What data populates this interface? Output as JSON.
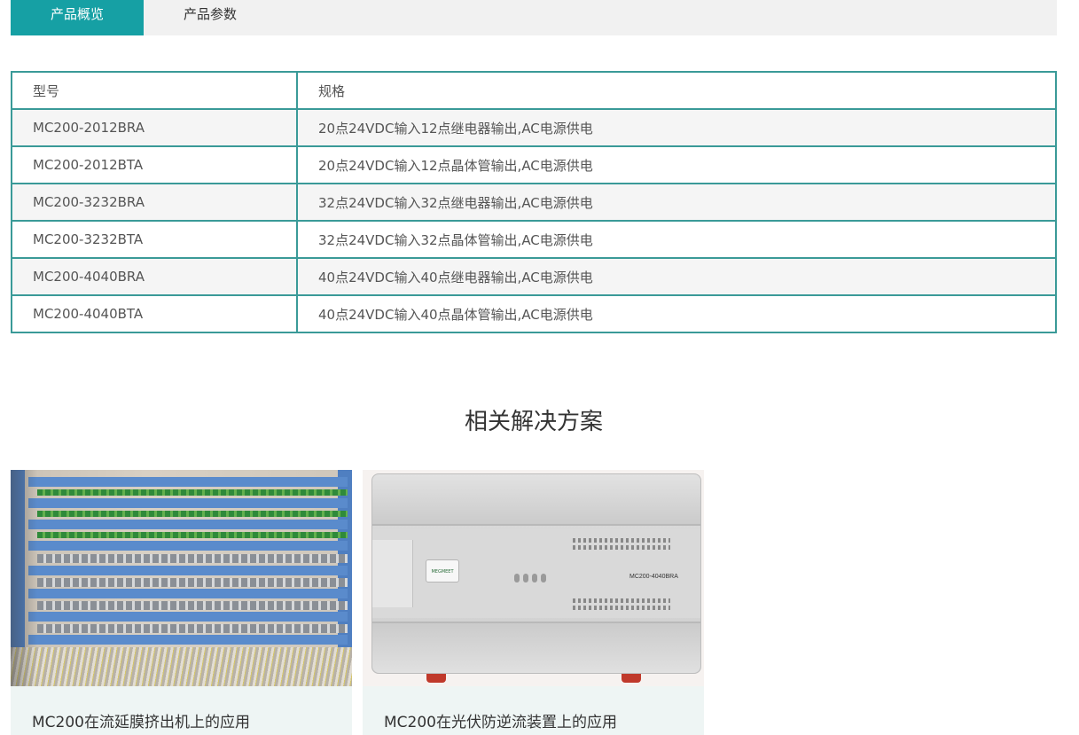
{
  "tabs": [
    {
      "label": "产品概览",
      "active": true
    },
    {
      "label": "产品参数",
      "active": false
    }
  ],
  "spec_table": {
    "headers": [
      "型号",
      "规格"
    ],
    "rows": [
      [
        "MC200-2012BRA",
        "20点24VDC输入12点继电器输出,AC电源供电"
      ],
      [
        "MC200-2012BTA",
        "20点24VDC输入12点晶体管输出,AC电源供电"
      ],
      [
        "MC200-3232BRA",
        "32点24VDC输入32点继电器输出,AC电源供电"
      ],
      [
        "MC200-3232BTA",
        "32点24VDC输入32点晶体管输出,AC电源供电"
      ],
      [
        "MC200-4040BRA",
        "40点24VDC输入40点继电器输出,AC电源供电"
      ],
      [
        "MC200-4040BTA",
        "40点24VDC输入40点晶体管输出,AC电源供电"
      ]
    ]
  },
  "solutions": {
    "title": "相关解决方案",
    "cards": [
      {
        "caption": "MC200在流延膜挤出机上的应用"
      },
      {
        "caption": "MC200在光伏防逆流装置上的应用"
      }
    ]
  },
  "plc_image": {
    "brand": "MEGMEET",
    "model": "MC200-4040BRA"
  },
  "colors": {
    "accent": "#16a0a4",
    "table_border": "#3a9a98",
    "tab_bar": "#f1f1f1",
    "card_bg": "#eef5f4"
  }
}
